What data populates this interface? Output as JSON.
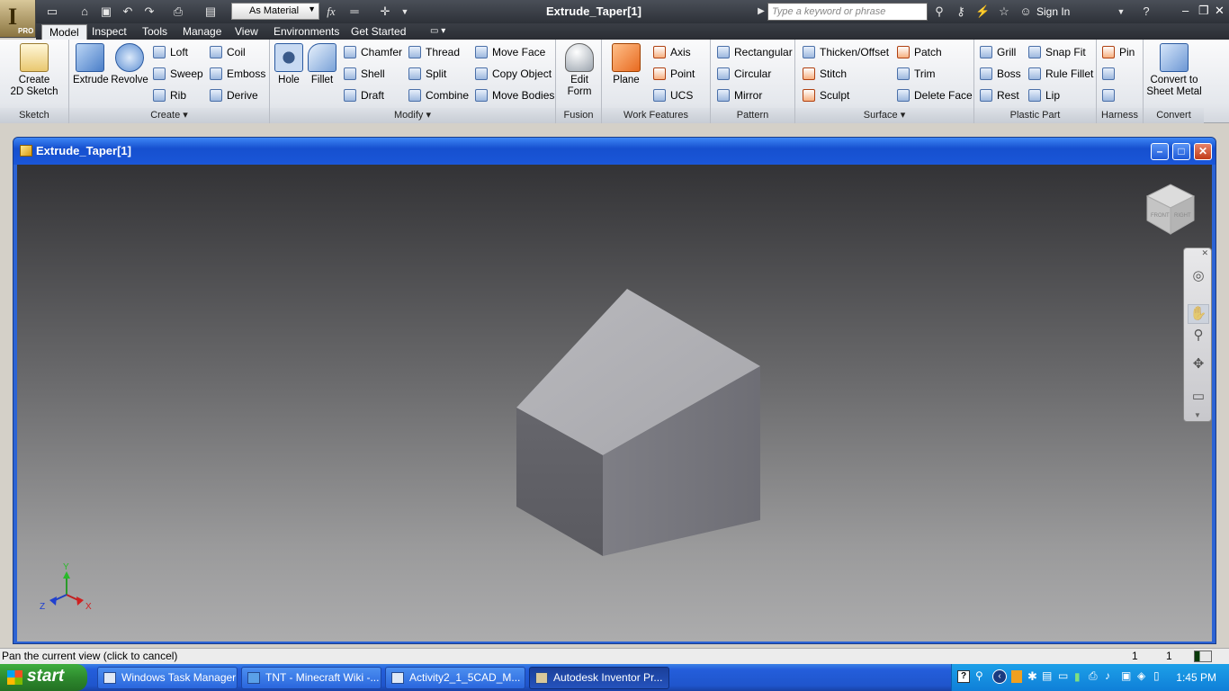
{
  "app": {
    "document_title": "Extrude_Taper[1]",
    "app_letter": "I",
    "edition_badge": "PRO"
  },
  "quick_access": {
    "material": "As Material",
    "fx": "fx"
  },
  "search": {
    "placeholder": "Type a keyword or phrase"
  },
  "sign_in": "Sign In",
  "tabs": [
    "Model",
    "Inspect",
    "Tools",
    "Manage",
    "View",
    "Environments",
    "Get Started"
  ],
  "ribbon": {
    "sketch": {
      "title": "Sketch",
      "create": "Create",
      "create2": "2D Sketch"
    },
    "create": {
      "title": "Create",
      "extrude": "Extrude",
      "revolve": "Revolve",
      "loft": "Loft",
      "sweep": "Sweep",
      "rib": "Rib",
      "coil": "Coil",
      "emboss": "Emboss",
      "derive": "Derive"
    },
    "modify": {
      "title": "Modify",
      "hole": "Hole",
      "fillet": "Fillet",
      "chamfer": "Chamfer",
      "shell": "Shell",
      "draft": "Draft",
      "thread": "Thread",
      "split": "Split",
      "combine": "Combine",
      "move_face": "Move Face",
      "copy_object": "Copy Object",
      "move_bodies": "Move Bodies"
    },
    "fusion": {
      "title": "Fusion",
      "edit": "Edit",
      "form": "Form"
    },
    "work_features": {
      "title": "Work Features",
      "plane": "Plane",
      "axis": "Axis",
      "point": "Point",
      "ucs": "UCS"
    },
    "pattern": {
      "title": "Pattern",
      "rectangular": "Rectangular",
      "circular": "Circular",
      "mirror": "Mirror"
    },
    "surface": {
      "title": "Surface",
      "thicken": "Thicken/Offset",
      "stitch": "Stitch",
      "sculpt": "Sculpt",
      "patch": "Patch",
      "trim": "Trim",
      "delete_face": "Delete Face"
    },
    "plastic_part": {
      "title": "Plastic Part",
      "grill": "Grill",
      "boss": "Boss",
      "rest": "Rest",
      "snap_fit": "Snap Fit",
      "rule_fillet": "Rule Fillet",
      "lip": "Lip"
    },
    "harness": {
      "title": "Harness",
      "pin": "Pin"
    },
    "convert": {
      "title": "Convert",
      "line1": "Convert to",
      "line2": "Sheet Metal"
    }
  },
  "document_window": {
    "title": "Extrude_Taper[1]"
  },
  "triad": {
    "x": "X",
    "y": "Y",
    "z": "Z"
  },
  "viewcube": {
    "front": "FRONT",
    "right": "RIGHT"
  },
  "status": {
    "message": "Pan the current view (click to cancel)",
    "count1": "1",
    "count2": "1"
  },
  "taskbar": {
    "start": "start",
    "items": [
      "Windows Task Manager",
      "TNT - Minecraft Wiki -...",
      "Activity2_1_5CAD_M...",
      "Autodesk Inventor Pr..."
    ],
    "clock": "1:45 PM"
  }
}
